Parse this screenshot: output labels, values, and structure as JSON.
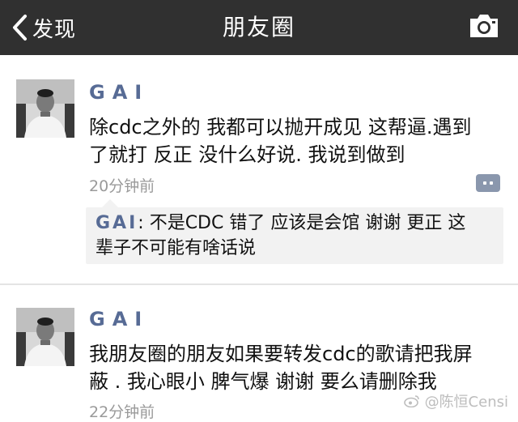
{
  "navbar": {
    "back_label": "发现",
    "title": "朋友圈"
  },
  "posts": [
    {
      "author": "GAI",
      "text_lines": [
        "除cdc之外的 我都可以抛开成见 这帮逼.遇到",
        "了就打 反正 没什么好说. 我说到做到"
      ],
      "time": "20分钟前",
      "comment": {
        "author": "GAI",
        "separator": ":",
        "line1": " 不是CDC 错了 应该是会馆 谢谢 更正 这",
        "line2": "辈子不可能有啥话说"
      }
    },
    {
      "author": "GAI",
      "text_lines": [
        "我朋友圈的朋友如果要转发cdc的歌请把我屏",
        "蔽 . 我心眼小 脾气爆 谢谢 要么请删除我"
      ],
      "time": "22分钟前"
    }
  ],
  "watermark": "@陈恒Censi",
  "colors": {
    "navbar": "#303030",
    "author": "#576b95",
    "time": "#9a9a9a",
    "comment_bg": "#f2f2f2"
  },
  "icons": {
    "back": "chevron-left-icon",
    "camera": "camera-icon",
    "comment": "comment-icon",
    "weibo": "weibo-icon"
  }
}
